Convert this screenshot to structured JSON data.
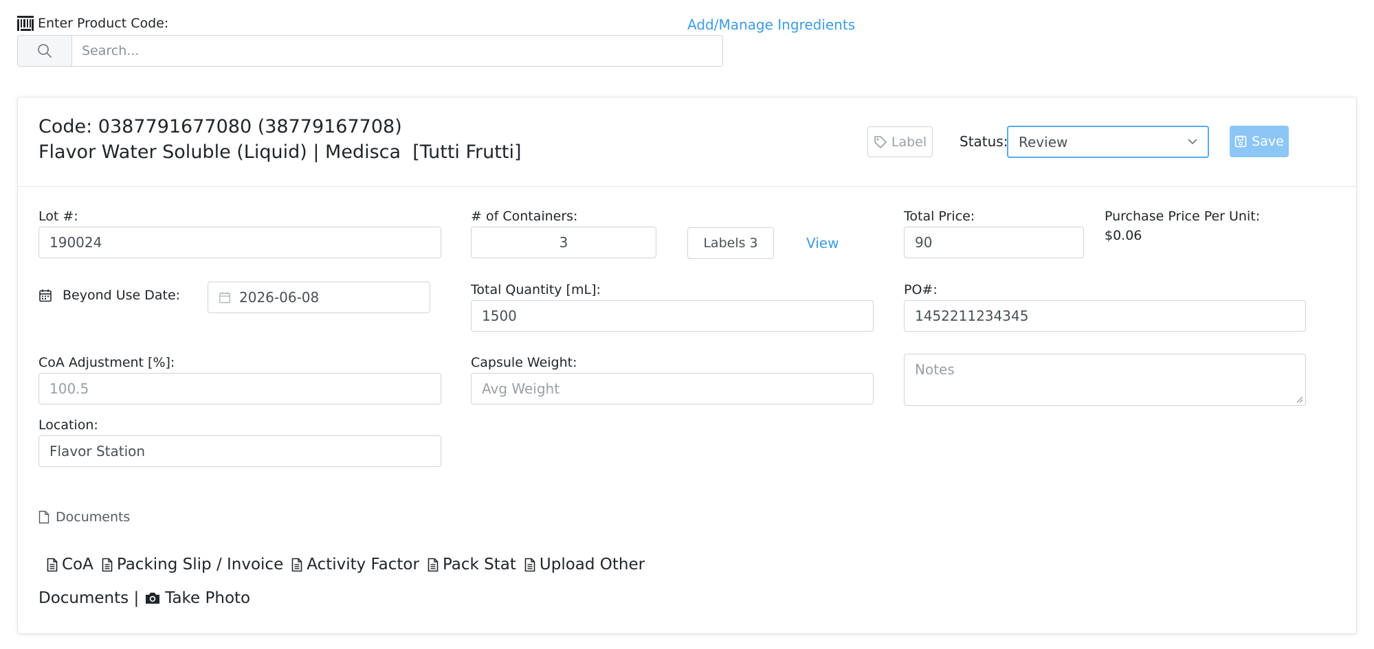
{
  "top": {
    "product_code_label": "Enter Product Code:",
    "manage_link": "Add/Manage Ingredients",
    "search_placeholder": "Search...",
    "search_value": ""
  },
  "header": {
    "code_line": "Code: 0387791677080 (38779167708)",
    "product_line": "Flavor Water Soluble (Liquid) | Medisca  [Tutti Frutti]",
    "label_button": "Label",
    "status_label": "Status:",
    "status_value": "Review",
    "save_button": "Save"
  },
  "form": {
    "lot_label": "Lot #:",
    "lot_value": "190024",
    "containers_label": "# of Containers:",
    "containers_value": "3",
    "labels_button": "Labels 3",
    "view_link": "View",
    "total_price_label": "Total Price:",
    "total_price_value": "90",
    "ppu_label": "Purchase Price Per Unit:",
    "ppu_value": "$0.06",
    "bud_label": "Beyond Use Date:",
    "bud_value": "2026-06-08",
    "total_qty_label": "Total Quantity [mL]:",
    "total_qty_value": "1500",
    "po_label": "PO#:",
    "po_value": "1452211234345",
    "coa_label": "CoA Adjustment [%]:",
    "coa_placeholder": "100.5",
    "capsule_label": "Capsule Weight:",
    "capsule_placeholder": "Avg Weight",
    "notes_placeholder": "Notes",
    "location_label": "Location:",
    "location_value": "Flavor Station"
  },
  "documents": {
    "header": "Documents",
    "links": [
      "CoA",
      "Packing Slip / Invoice",
      "Activity Factor",
      "Pack Stat",
      "Upload Other"
    ],
    "trailing_text": "Documents |",
    "take_photo": "Take Photo"
  },
  "colors": {
    "accent": "#3b9ae8",
    "save_bg": "#8cc6f7",
    "border": "#ced4da"
  },
  "icons": {
    "barcode": "barcode-icon",
    "search": "search-icon",
    "tag": "tag-icon",
    "chevron": "chevron-down-icon",
    "save": "floppy-disk-icon",
    "calendar": "calendar-icon",
    "file": "file-icon",
    "file_text": "file-text-icon",
    "camera": "camera-icon"
  }
}
